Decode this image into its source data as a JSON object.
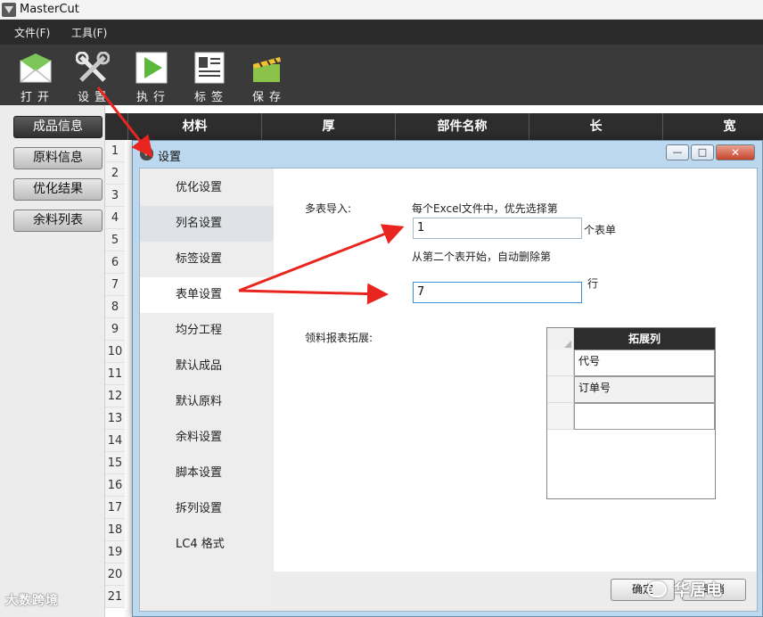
{
  "app": {
    "title": "MasterCut"
  },
  "menu": [
    {
      "label": "文件(F)"
    },
    {
      "label": "工具(F)"
    }
  ],
  "toolbar": [
    {
      "label": "打开",
      "icon": "open-envelope-icon"
    },
    {
      "label": "设置",
      "icon": "wrench-screwdriver-icon"
    },
    {
      "label": "执行",
      "icon": "play-icon"
    },
    {
      "label": "标签",
      "icon": "label-document-icon"
    },
    {
      "label": "保存",
      "icon": "save-clapper-icon"
    }
  ],
  "sidebar": [
    {
      "label": "成品信息",
      "active": true
    },
    {
      "label": "原料信息",
      "active": false
    },
    {
      "label": "优化结果",
      "active": false
    },
    {
      "label": "余料列表",
      "active": false
    }
  ],
  "grid": {
    "columns": [
      "材料",
      "厚",
      "部件名称",
      "长",
      "宽"
    ],
    "row_numbers": [
      "1",
      "2",
      "3",
      "4",
      "5",
      "6",
      "7",
      "8",
      "9",
      "10",
      "11",
      "12",
      "13",
      "14",
      "15",
      "16",
      "17",
      "18",
      "19",
      "20",
      "21"
    ]
  },
  "dialog": {
    "title": "设置",
    "window_buttons": {
      "minimize": "—",
      "maximize": "□",
      "close": "✕"
    },
    "nav": [
      {
        "label": "优化设置"
      },
      {
        "label": "列名设置"
      },
      {
        "label": "标签设置"
      },
      {
        "label": "表单设置",
        "selected": true
      },
      {
        "label": "均分工程"
      },
      {
        "label": "默认成品"
      },
      {
        "label": "默认原料"
      },
      {
        "label": "余料设置"
      },
      {
        "label": "脚本设置"
      },
      {
        "label": "拆列设置"
      },
      {
        "label": "LC4 格式"
      }
    ],
    "multi_sheet": {
      "label": "多表导入:",
      "hint1": "每个Excel文件中，优先选择第",
      "sheet_index": "1",
      "sheet_suffix": "个表单",
      "hint2": "从第二个表开始，自动删除第",
      "delete_rows": "7",
      "rows_suffix": "行"
    },
    "report_ext": {
      "label": "领料报表拓展:",
      "column_header": "拓展列",
      "rows": [
        "代号",
        "订单号",
        ""
      ]
    },
    "buttons": {
      "ok": "确定",
      "cancel": "取消"
    }
  },
  "watermarks": {
    "left": "大数跨境",
    "right": "华居电"
  },
  "colors": {
    "toolbar": "#3a3a3a",
    "grid_header": "#2d2d2d",
    "dialog_frame": "#bcd8ee",
    "arrow": "#e8261f",
    "focus": "#3c8fd6"
  }
}
